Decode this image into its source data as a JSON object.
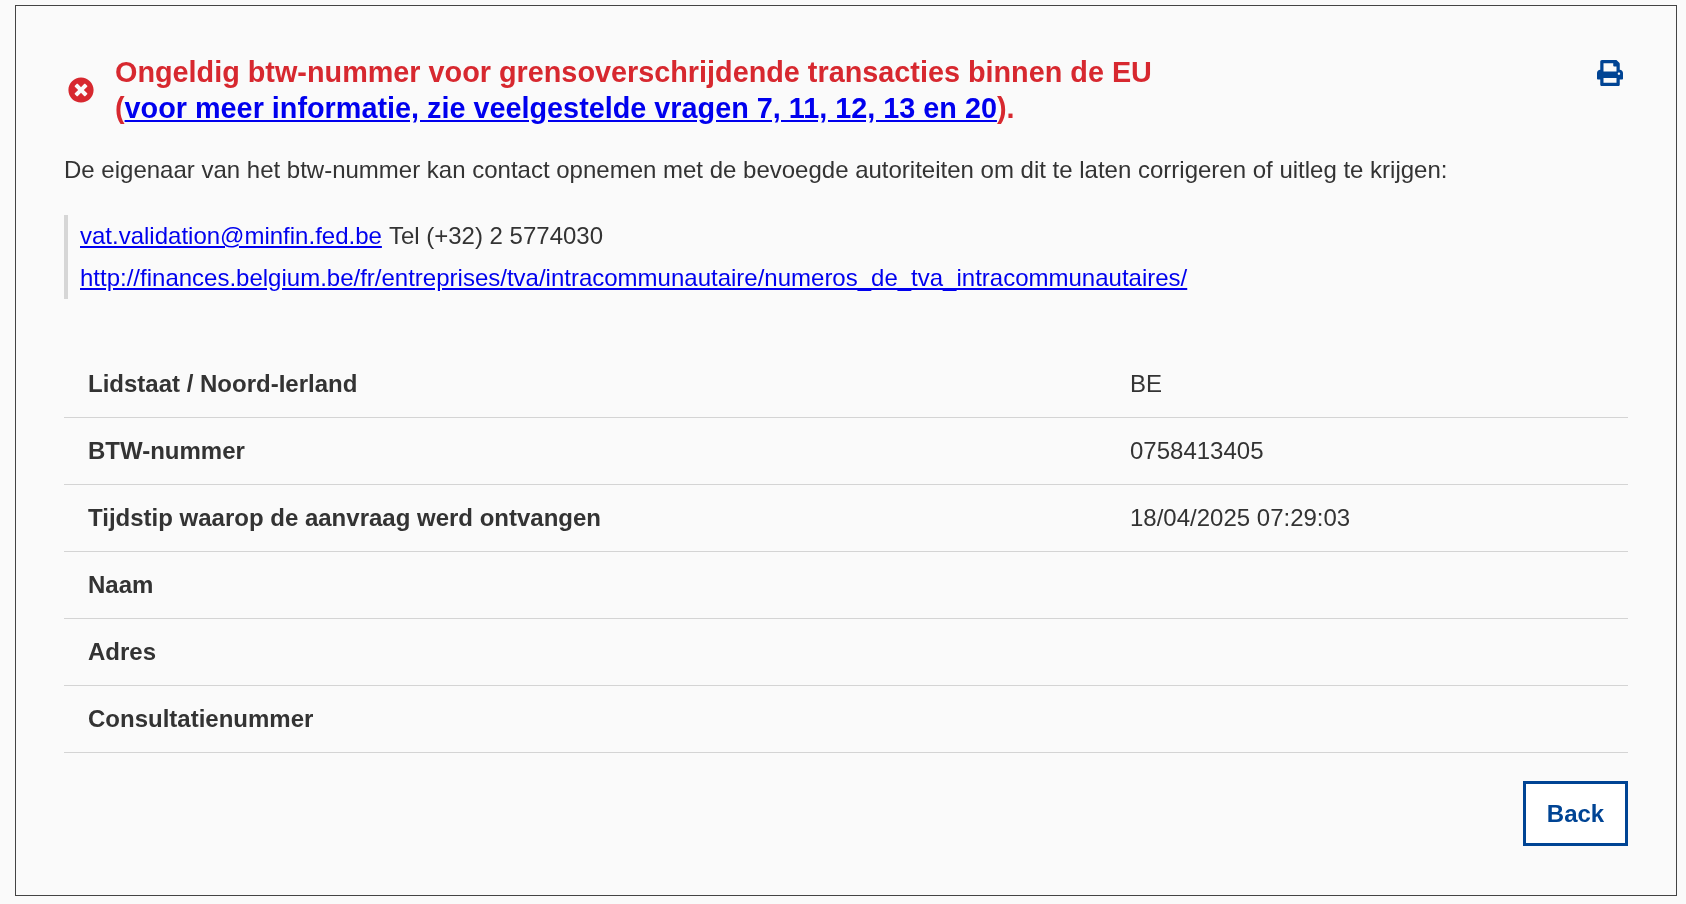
{
  "heading": {
    "kind": "error",
    "text": "Ongeldig btw-nummer voor grensoverschrijdende transacties binnen de EU (",
    "link": "voor meer informatie, zie veelgestelde vragen 7, 11, 12, 13 en 20",
    "after": ")."
  },
  "intro": "De eigenaar van het btw-nummer kan contact opnemen met de bevoegde autoriteiten om dit te laten corrigeren of uitleg te krijgen:",
  "contact": {
    "email": "vat.validation@minfin.fed.be",
    "phone": "Tel (+32) 2 5774030",
    "url": "http://finances.belgium.be/fr/entreprises/tva/intracommunautaire/numeros_de_tva_intracommunautaires/"
  },
  "table": {
    "rows": [
      {
        "label": "Lidstaat / Noord-Ierland",
        "value": "BE"
      },
      {
        "label": "BTW-nummer",
        "value": "0758413405"
      },
      {
        "label": "Tijdstip waarop de aanvraag werd ontvangen",
        "value": "18/04/2025 07:29:03"
      },
      {
        "label": "Naam"
      },
      {
        "label": "Adres"
      },
      {
        "label": "Consultatienummer"
      }
    ]
  },
  "back_button": "Back"
}
